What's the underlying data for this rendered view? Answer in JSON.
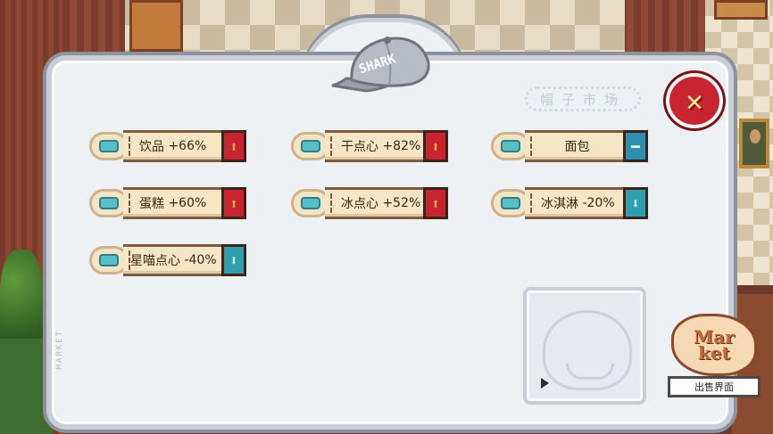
{
  "panel": {
    "title": "帽子市场",
    "side_label": "MARKET",
    "hat_text": "SHARK",
    "close_icon": "close-x-icon"
  },
  "modifiers": [
    {
      "name": "饮品",
      "value": "+66%",
      "trend": "up",
      "icon": "drink-icon"
    },
    {
      "name": "干点心",
      "value": "+82%",
      "trend": "up",
      "icon": "dry-snack-icon"
    },
    {
      "name": "面包",
      "value": "",
      "trend": "neutral",
      "icon": "bread-icon"
    },
    {
      "name": "蛋糕",
      "value": "+60%",
      "trend": "up",
      "icon": "cake-icon"
    },
    {
      "name": "冰点心",
      "value": "+52%",
      "trend": "up",
      "icon": "ice-snack-icon"
    },
    {
      "name": "冰淇淋",
      "value": "-20%",
      "trend": "down",
      "icon": "ice-cream-icon"
    },
    {
      "name": "星喵点心",
      "value": "-40%",
      "trend": "down",
      "icon": "star-cat-snack-icon"
    }
  ],
  "market_logo": {
    "line1": "Mar",
    "line2": "ket"
  },
  "sell_button": "出售界面",
  "colors": {
    "up": "#c8242f",
    "down": "#2f9fb0",
    "panel": "#eef1f4"
  }
}
